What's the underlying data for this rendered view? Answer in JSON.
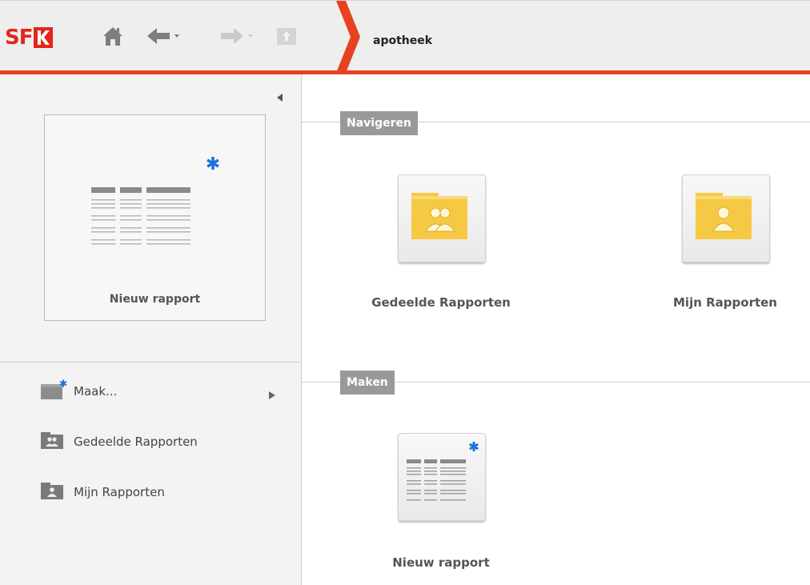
{
  "brand": {
    "logo_text": "SF",
    "accent": "#e8411f",
    "logo_color": "#e4261c"
  },
  "toolbar": {
    "icons": [
      "home-icon",
      "back-arrow-icon",
      "forward-arrow-icon",
      "up-folder-icon"
    ]
  },
  "breadcrumb": {
    "current": "apotheek"
  },
  "left_panel": {
    "card_label": "Nieuw rapport",
    "items": [
      {
        "label": "Maak...",
        "icon": "new-report-icon",
        "has_submenu": true
      },
      {
        "label": "Gedeelde Rapporten",
        "icon": "shared-folder-icon"
      },
      {
        "label": "Mijn Rapporten",
        "icon": "my-folder-icon"
      }
    ]
  },
  "main": {
    "navigate": {
      "title": "Navigeren",
      "tiles": [
        {
          "label": "Gedeelde Rapporten",
          "icon": "shared-folder-icon"
        },
        {
          "label": "Mijn Rapporten",
          "icon": "my-folder-icon"
        }
      ]
    },
    "create": {
      "title": "Maken",
      "tiles": [
        {
          "label": "Nieuw rapport",
          "icon": "new-report-icon"
        }
      ]
    }
  },
  "colors": {
    "section_badge": "#999999",
    "folder": "#f6c944",
    "star": "#1a73d9"
  }
}
